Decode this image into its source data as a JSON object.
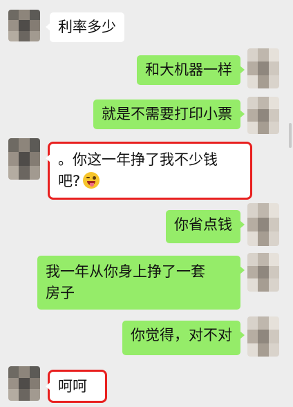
{
  "conversation": {
    "messages": [
      {
        "side": "left",
        "text": "利率多少"
      },
      {
        "side": "right",
        "text": "和大机器一样"
      },
      {
        "side": "right",
        "text": "就是不需要打印小票"
      },
      {
        "side": "left",
        "line1": "。你这一年挣了我不少钱",
        "line2": "吧?",
        "emoji": "winking-tongue-emoji",
        "highlighted": true
      },
      {
        "side": "right",
        "text": "你省点钱"
      },
      {
        "side": "right",
        "line1": "我一年从你身上挣了一套",
        "line2": "房子"
      },
      {
        "side": "right",
        "text": "你觉得，对不对"
      },
      {
        "side": "left",
        "text": "呵呵",
        "highlighted": true
      }
    ]
  },
  "colors": {
    "background": "#ededed",
    "sent_bubble": "#95ec69",
    "received_bubble": "#ffffff",
    "highlight_box": "#e8201f"
  }
}
